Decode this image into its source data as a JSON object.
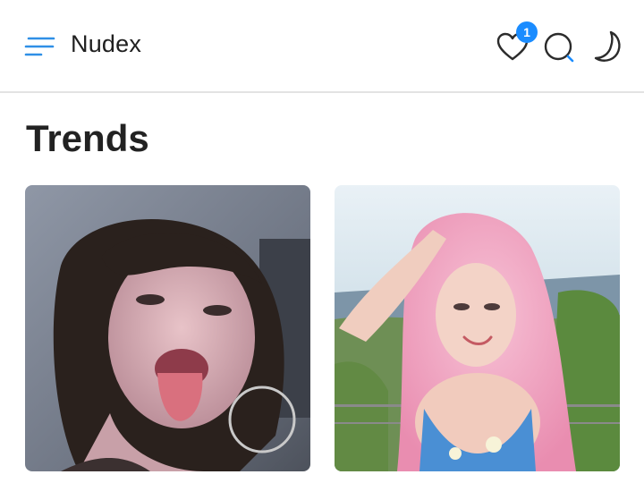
{
  "header": {
    "brand": "Nudex",
    "favorites_count": "1"
  },
  "icons": {
    "menu": "menu-icon",
    "favorites": "heart-icon",
    "search": "search-icon",
    "theme": "moon-icon"
  },
  "colors": {
    "accent": "#1a8cff",
    "divider": "#e3e3e3"
  },
  "main": {
    "section_title": "Trends",
    "cards": [
      {
        "kind": "photo"
      },
      {
        "kind": "photo"
      }
    ]
  }
}
